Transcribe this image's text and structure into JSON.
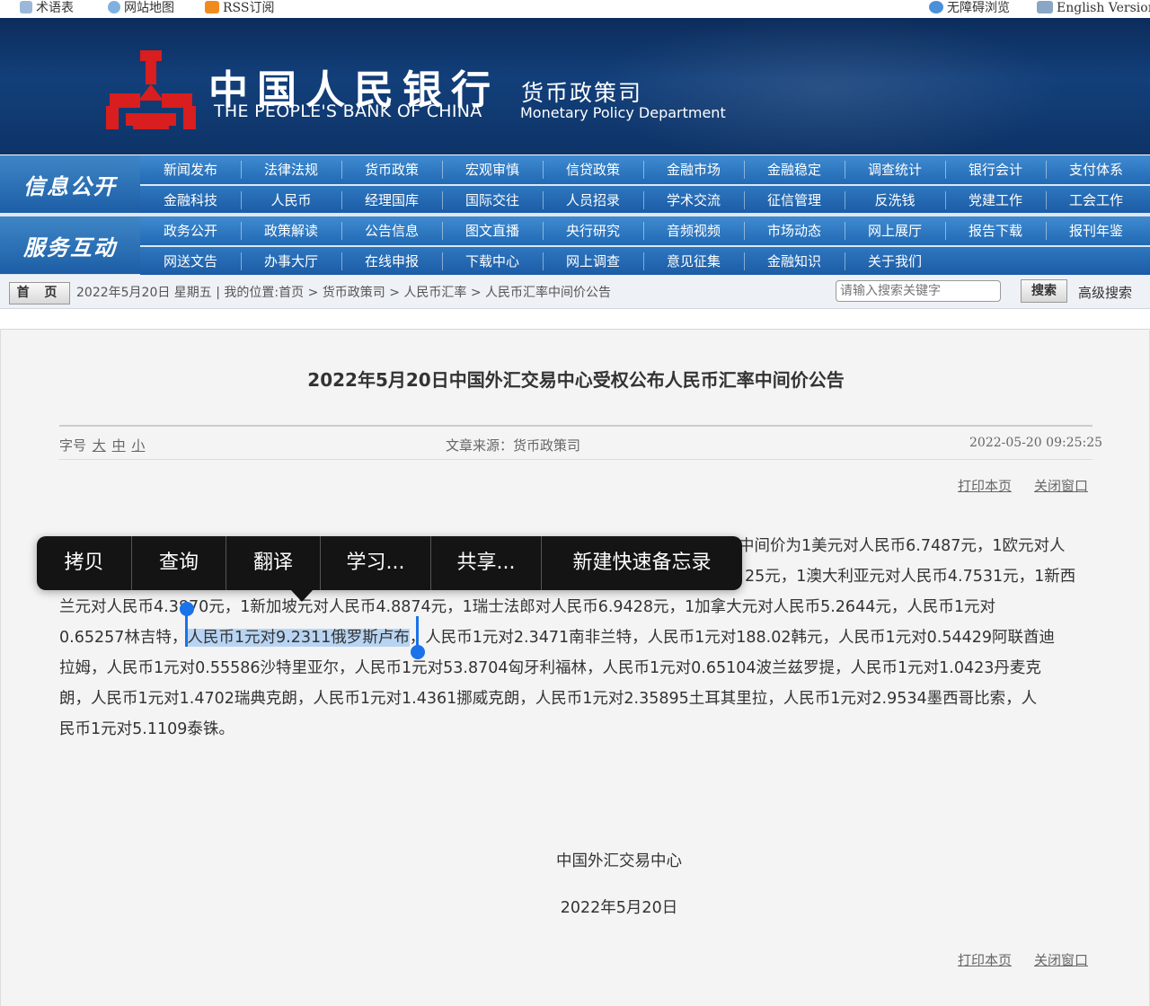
{
  "topbar": {
    "glossary": "术语表",
    "sitemap": "网站地图",
    "rss": "RSS订阅",
    "accessibility": "无障碍浏览",
    "english": "English Version"
  },
  "header": {
    "bank_cn": "中国人民银行",
    "bank_en": "THE PEOPLE'S BANK OF CHINA",
    "dept_cn": "货币政策司",
    "dept_en": "Monetary Policy Department"
  },
  "nav": {
    "block1_label": "信息公开",
    "block2_label": "服务互动",
    "row1": [
      "新闻发布",
      "法律法规",
      "货币政策",
      "宏观审慎",
      "信贷政策",
      "金融市场",
      "金融稳定",
      "调查统计",
      "银行会计",
      "支付体系"
    ],
    "row2": [
      "金融科技",
      "人民币",
      "经理国库",
      "国际交往",
      "人员招录",
      "学术交流",
      "征信管理",
      "反洗钱",
      "党建工作",
      "工会工作"
    ],
    "row3": [
      "政务公开",
      "政策解读",
      "公告信息",
      "图文直播",
      "央行研究",
      "音频视频",
      "市场动态",
      "网上展厅",
      "报告下载",
      "报刊年鉴"
    ],
    "row4": [
      "网送文告",
      "办事大厅",
      "在线申报",
      "下载中心",
      "网上调查",
      "意见征集",
      "金融知识",
      "关于我们"
    ]
  },
  "breadcrumb": {
    "home": "首 页",
    "text": "2022年5月20日 星期五 | 我的位置:首页 > 货币政策司 > 人民币汇率 > 人民币汇率中间价公告",
    "search_placeholder": "请输入搜索关键字",
    "search_button": "搜索",
    "advanced_search": "高级搜索"
  },
  "article": {
    "title": "2022年5月20日中国外汇交易中心受权公布人民币汇率中间价公告",
    "fontsize_label": "字号",
    "fontsize_large": "大",
    "fontsize_medium": "中",
    "fontsize_small": "小",
    "source": "文章来源：货币政策司",
    "time": "2022-05-20 09:25:25",
    "print": "打印本页",
    "close": "关闭窗口",
    "lines": {
      "l1": "中间价为1美元对人民币6.7487元，1欧元对人",
      "l2": "25元，1澳大利亚元对人民币4.7531元，1新西",
      "l3": "兰元对人民币4.3870元，1新加坡元对人民币4.8874元，1瑞士法郎对人民币6.9428元，1加拿大元对人民币5.2644元，人民币1元对",
      "l4_pre": "0.65257林吉特，",
      "l4_sel": "人民币1元对9.2311俄罗斯卢布",
      "l4_post": "，人民币1元对2.3471南非兰特，人民币1元对188.02韩元，人民币1元对0.54429阿联酋迪",
      "l5": "拉姆，人民币1元对0.55586沙特里亚尔，人民币1元对53.8704匈牙利福林，人民币1元对0.65104波兰兹罗提，人民币1元对1.0423丹麦克",
      "l6": "朗，人民币1元对1.4702瑞典克朗，人民币1元对1.4361挪威克朗，人民币1元对2.35895土耳其里拉，人民币1元对2.9534墨西哥比索，人",
      "l7": "民币1元对5.1109泰铢。"
    },
    "sign_org": "中国外汇交易中心",
    "sign_date": "2022年5月20日"
  },
  "context_menu": {
    "items": [
      "拷贝",
      "查询",
      "翻译",
      "学习...",
      "共享...",
      "新建快速备忘录"
    ]
  },
  "colors": {
    "header_bg": "#123f7a",
    "nav_blue": "#2a72bb",
    "logo_red": "#d81e1e",
    "selection": "#b8d4f2",
    "handle": "#1a73e8"
  }
}
